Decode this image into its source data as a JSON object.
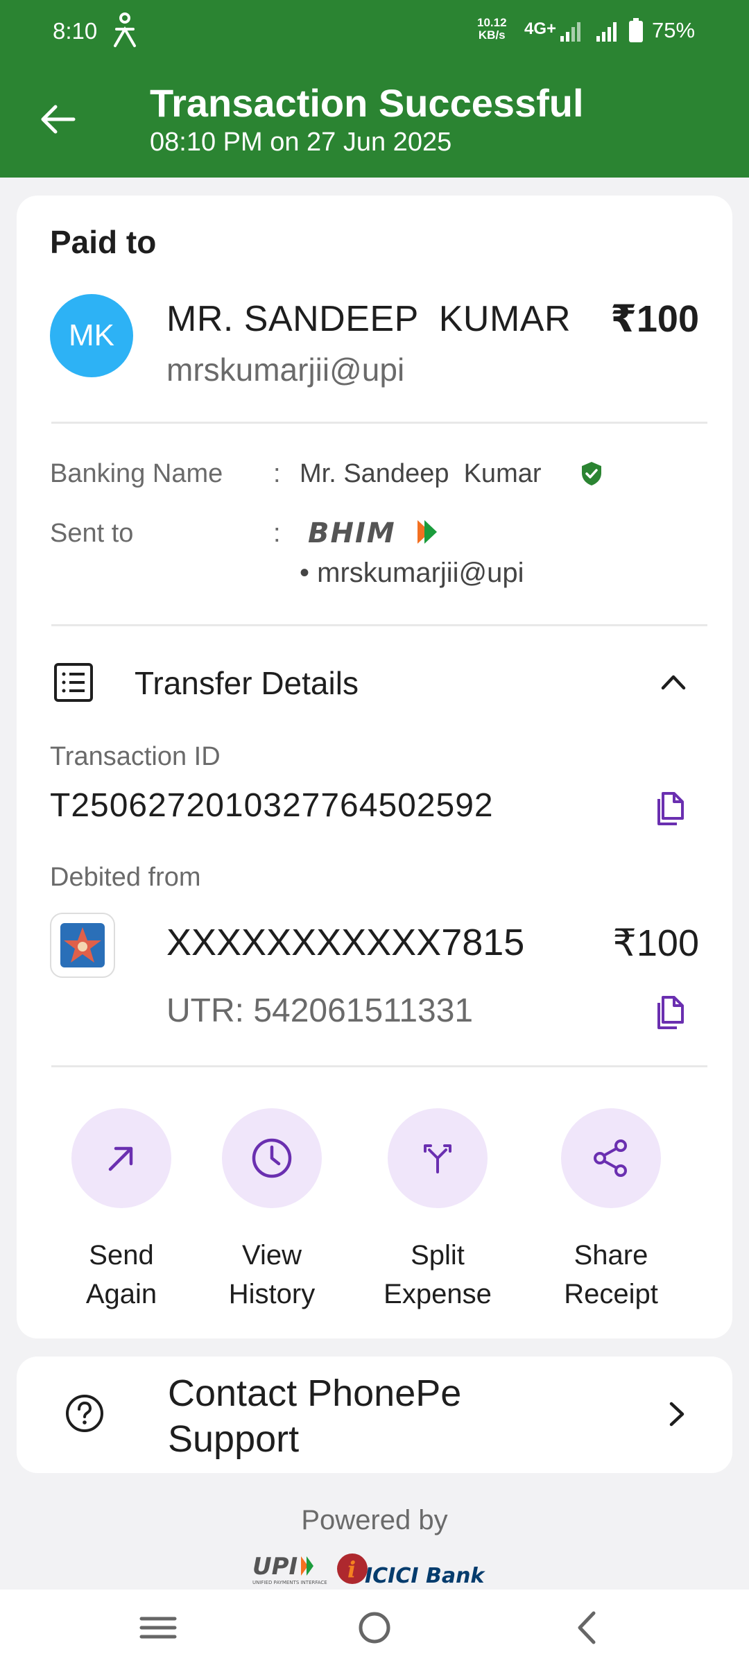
{
  "status_bar": {
    "time": "8:10",
    "speed_value": "10.12",
    "speed_unit": "KB/s",
    "network": "4G+",
    "battery": "75%"
  },
  "header": {
    "title": "Transaction Successful",
    "subtitle": "08:10 PM on 27 Jun 2025",
    "bg_color": "#2b8432"
  },
  "paid_to": {
    "label": "Paid to",
    "avatar_initials": "MK",
    "avatar_color": "#2db2f5",
    "name": "MR. SANDEEP  KUMAR",
    "amount": "₹100",
    "vpa": "mrskumarjii@upi"
  },
  "details": {
    "banking_name_label": "Banking Name",
    "colon": ":",
    "banking_name": "Mr. Sandeep  Kumar",
    "sent_to_label": "Sent to",
    "sent_to_logo": "BHIM",
    "sent_to_vpa": "• mrskumarjii@upi"
  },
  "transfer": {
    "title": "Transfer Details",
    "transaction_id_label": "Transaction ID",
    "transaction_id": "T2506272010327764502592",
    "debited_label": "Debited from",
    "account": "XXXXXXXXXXX7815",
    "amount": "₹100",
    "utr": "UTR: 542061511331"
  },
  "actions": [
    {
      "label": "Send\nAgain",
      "icon": "arrow-up-right-icon"
    },
    {
      "label": "View\nHistory",
      "icon": "clock-icon"
    },
    {
      "label": "Split\nExpense",
      "icon": "split-icon"
    },
    {
      "label": "Share\nReceipt",
      "icon": "share-icon"
    }
  ],
  "support": {
    "label": "Contact PhonePe Support"
  },
  "footer": {
    "powered_by": "Powered by",
    "brand_upi": "UPI",
    "brand_upi_sub": "UNIFIED PAYMENTS INTERFACE",
    "brand_bank": "ICICI Bank"
  },
  "accent_color": "#6a2fb0"
}
